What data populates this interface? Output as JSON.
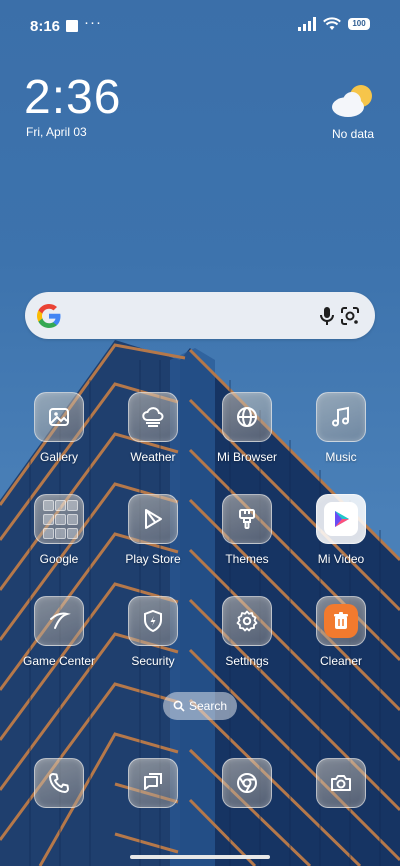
{
  "status_bar": {
    "time": "8:16",
    "dots": "···",
    "battery": "100"
  },
  "clock": {
    "time": "2:36",
    "date": "Fri, April 03"
  },
  "weather": {
    "text": "No data",
    "icon": "partly-cloudy-icon"
  },
  "search_bar": {
    "logo": "google-g-icon",
    "mic_icon": "microphone-icon",
    "lens_icon": "google-lens-icon"
  },
  "apps": [
    {
      "label": "Gallery",
      "icon": "gallery-icon"
    },
    {
      "label": "Weather",
      "icon": "weather-icon"
    },
    {
      "label": "Mi Browser",
      "icon": "globe-icon"
    },
    {
      "label": "Music",
      "icon": "music-note-icon"
    },
    {
      "label": "Google",
      "icon": "folder-icon"
    },
    {
      "label": "Play Store",
      "icon": "play-store-icon"
    },
    {
      "label": "Themes",
      "icon": "brush-icon"
    },
    {
      "label": "Mi Video",
      "icon": "play-video-icon"
    },
    {
      "label": "Game Center",
      "icon": "boomerang-icon"
    },
    {
      "label": "Security",
      "icon": "shield-bolt-icon"
    },
    {
      "label": "Settings",
      "icon": "gear-icon"
    },
    {
      "label": "Cleaner",
      "icon": "trash-icon"
    }
  ],
  "search_pill": {
    "label": "Search"
  },
  "dock": [
    {
      "icon": "phone-icon"
    },
    {
      "icon": "message-icon"
    },
    {
      "icon": "chrome-icon"
    },
    {
      "icon": "camera-icon"
    }
  ]
}
